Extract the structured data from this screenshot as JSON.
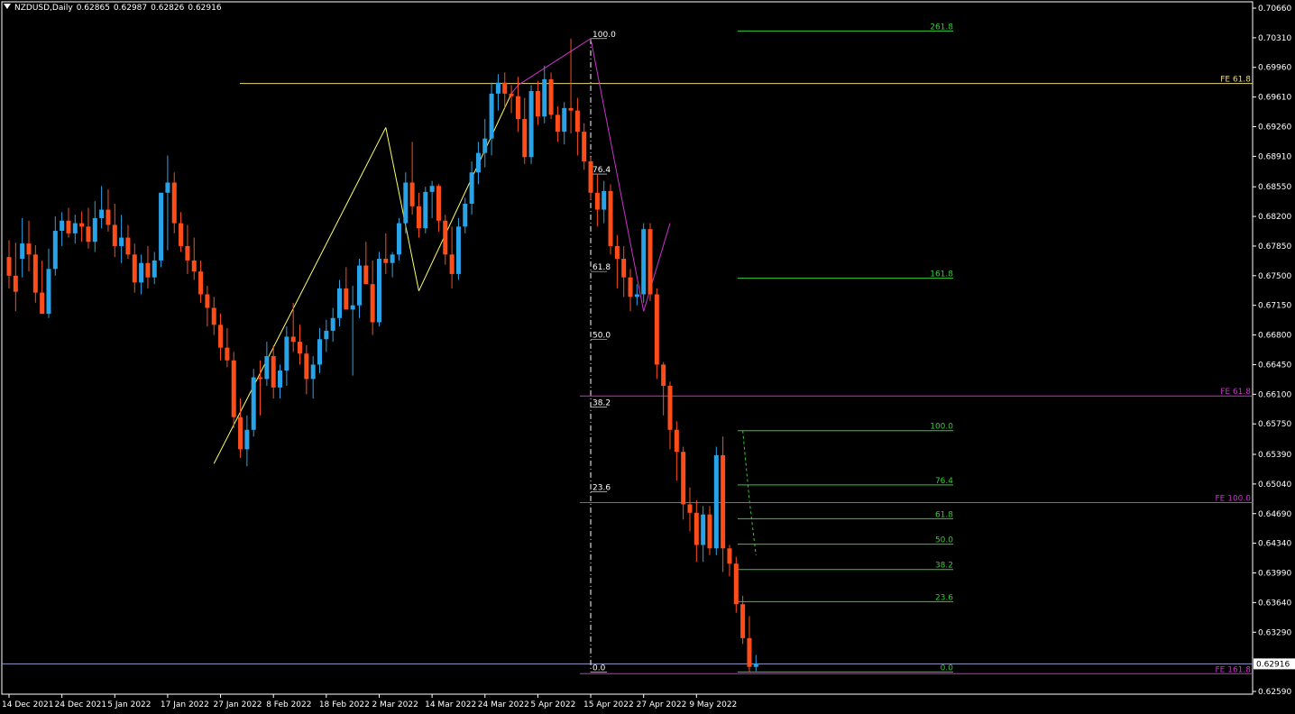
{
  "header": {
    "symbol": "NZDUSD,Daily",
    "open": "0.62865",
    "high": "0.62987",
    "low": "0.62826",
    "close": "0.62916"
  },
  "colors": {
    "background": "#000000",
    "bull": "#29a3e8",
    "bear": "#ff4d1a",
    "wick_bull": "#29a3e8",
    "wick_bear": "#ff4d1a",
    "axis": "#ffffff",
    "grid_text": "#ffffff",
    "zigzag_up": "#ffff66",
    "zigzag_down": "#cc33cc",
    "fibo_green": "#33cc33",
    "fe_yellow": "#e6d875",
    "fe_magenta": "#cc33cc",
    "current_price": "#9999cc"
  },
  "chart_data": {
    "type": "candlestick",
    "ylim": [
      0.6259,
      0.7066
    ],
    "y_ticks": [
      "0.70660",
      "0.70310",
      "0.69960",
      "0.69610",
      "0.69260",
      "0.68910",
      "0.68550",
      "0.68200",
      "0.67850",
      "0.67500",
      "0.67150",
      "0.66800",
      "0.66450",
      "0.66100",
      "0.65750",
      "0.65390",
      "0.65040",
      "0.64690",
      "0.64340",
      "0.63990",
      "0.63640",
      "0.63290",
      "0.62590"
    ],
    "current_price_label": "0.62916",
    "current_price": 0.62916,
    "x_ticks": [
      "14 Dec 2021",
      "24 Dec 2021",
      "5 Jan 2022",
      "17 Jan 2022",
      "27 Jan 2022",
      "8 Feb 2022",
      "18 Feb 2022",
      "2 Mar 2022",
      "14 Mar 2022",
      "24 Mar 2022",
      "5 Apr 2022",
      "15 Apr 2022",
      "27 Apr 2022",
      "9 May 2022"
    ],
    "candles": [
      [
        0.6772,
        0.6792,
        0.6735,
        0.675
      ],
      [
        0.675,
        0.6789,
        0.6708,
        0.6731
      ],
      [
        0.677,
        0.6818,
        0.6748,
        0.6788
      ],
      [
        0.6788,
        0.6815,
        0.6755,
        0.6775
      ],
      [
        0.6775,
        0.6786,
        0.6718,
        0.673
      ],
      [
        0.673,
        0.6768,
        0.6705,
        0.6705
      ],
      [
        0.6705,
        0.6782,
        0.67,
        0.6758
      ],
      [
        0.6758,
        0.682,
        0.675,
        0.6803
      ],
      [
        0.6803,
        0.6825,
        0.6785,
        0.6815
      ],
      [
        0.6815,
        0.683,
        0.6795,
        0.68
      ],
      [
        0.68,
        0.6822,
        0.6788,
        0.6812
      ],
      [
        0.6812,
        0.6826,
        0.679,
        0.6808
      ],
      [
        0.6808,
        0.683,
        0.6782,
        0.679
      ],
      [
        0.679,
        0.6838,
        0.6778,
        0.6818
      ],
      [
        0.6818,
        0.6856,
        0.6806,
        0.6828
      ],
      [
        0.6828,
        0.6852,
        0.6802,
        0.681
      ],
      [
        0.681,
        0.6835,
        0.6772,
        0.6785
      ],
      [
        0.6785,
        0.6822,
        0.6765,
        0.6795
      ],
      [
        0.6795,
        0.681,
        0.677,
        0.6775
      ],
      [
        0.6775,
        0.6788,
        0.673,
        0.6742
      ],
      [
        0.6742,
        0.6775,
        0.6728,
        0.6765
      ],
      [
        0.6765,
        0.6785,
        0.6735,
        0.6748
      ],
      [
        0.6748,
        0.6778,
        0.674,
        0.6768
      ],
      [
        0.6768,
        0.6822,
        0.676,
        0.6848
      ],
      [
        0.6848,
        0.6892,
        0.678,
        0.686
      ],
      [
        0.686,
        0.6872,
        0.68,
        0.6812
      ],
      [
        0.6812,
        0.6825,
        0.6778,
        0.6785
      ],
      [
        0.6785,
        0.681,
        0.6752,
        0.6768
      ],
      [
        0.6768,
        0.6795,
        0.6745,
        0.6755
      ],
      [
        0.6755,
        0.6768,
        0.6718,
        0.6728
      ],
      [
        0.6728,
        0.6738,
        0.669,
        0.6712
      ],
      [
        0.6712,
        0.6725,
        0.668,
        0.6692
      ],
      [
        0.6692,
        0.6705,
        0.665,
        0.6665
      ],
      [
        0.6665,
        0.6688,
        0.6642,
        0.665
      ],
      [
        0.665,
        0.666,
        0.657,
        0.6583
      ],
      [
        0.6583,
        0.6605,
        0.6535,
        0.6545
      ],
      [
        0.6545,
        0.6585,
        0.6525,
        0.6568
      ],
      [
        0.6568,
        0.664,
        0.656,
        0.663
      ],
      [
        0.663,
        0.665,
        0.6585,
        0.6628
      ],
      [
        0.6628,
        0.6672,
        0.662,
        0.6655
      ],
      [
        0.6655,
        0.6668,
        0.6605,
        0.6618
      ],
      [
        0.6618,
        0.6645,
        0.6605,
        0.6638
      ],
      [
        0.6638,
        0.669,
        0.662,
        0.6678
      ],
      [
        0.6678,
        0.6718,
        0.666,
        0.6672
      ],
      [
        0.6672,
        0.6692,
        0.6645,
        0.6658
      ],
      [
        0.6658,
        0.6668,
        0.661,
        0.6628
      ],
      [
        0.6628,
        0.6655,
        0.6605,
        0.6645
      ],
      [
        0.6645,
        0.6688,
        0.6635,
        0.6675
      ],
      [
        0.6675,
        0.6698,
        0.666,
        0.6685
      ],
      [
        0.6685,
        0.6712,
        0.6672,
        0.67
      ],
      [
        0.67,
        0.6745,
        0.669,
        0.6735
      ],
      [
        0.6735,
        0.676,
        0.672,
        0.671
      ],
      [
        0.671,
        0.6738,
        0.6632,
        0.6715
      ],
      [
        0.6715,
        0.677,
        0.67,
        0.6762
      ],
      [
        0.6762,
        0.679,
        0.674,
        0.674
      ],
      [
        0.674,
        0.6768,
        0.668,
        0.6695
      ],
      [
        0.6695,
        0.6778,
        0.669,
        0.677
      ],
      [
        0.677,
        0.68,
        0.6752,
        0.6765
      ],
      [
        0.6765,
        0.6778,
        0.6748,
        0.6775
      ],
      [
        0.6775,
        0.6818,
        0.6768,
        0.6812
      ],
      [
        0.6812,
        0.6872,
        0.68,
        0.686
      ],
      [
        0.686,
        0.6908,
        0.6822,
        0.6832
      ],
      [
        0.6832,
        0.6848,
        0.6795,
        0.6806
      ],
      [
        0.6806,
        0.6855,
        0.68,
        0.6849
      ],
      [
        0.6849,
        0.6862,
        0.6818,
        0.6856
      ],
      [
        0.6856,
        0.6858,
        0.6802,
        0.6815
      ],
      [
        0.6815,
        0.6822,
        0.6763,
        0.6775
      ],
      [
        0.6775,
        0.6808,
        0.6735,
        0.6752
      ],
      [
        0.6752,
        0.6818,
        0.6745,
        0.6808
      ],
      [
        0.6808,
        0.6842,
        0.68,
        0.6835
      ],
      [
        0.6835,
        0.6885,
        0.6822,
        0.6872
      ],
      [
        0.6872,
        0.6908,
        0.6858,
        0.6895
      ],
      [
        0.6895,
        0.6935,
        0.6878,
        0.6912
      ],
      [
        0.6912,
        0.6978,
        0.6892,
        0.6965
      ],
      [
        0.6965,
        0.6988,
        0.6945,
        0.6978
      ],
      [
        0.6978,
        0.699,
        0.6948,
        0.6965
      ],
      [
        0.6965,
        0.6975,
        0.6942,
        0.6962
      ],
      [
        0.6962,
        0.6985,
        0.692,
        0.6935
      ],
      [
        0.6935,
        0.696,
        0.6882,
        0.689
      ],
      [
        0.689,
        0.6975,
        0.6882,
        0.6968
      ],
      [
        0.6968,
        0.698,
        0.6928,
        0.6938
      ],
      [
        0.6938,
        0.6998,
        0.693,
        0.6982
      ],
      [
        0.6982,
        0.699,
        0.6935,
        0.694
      ],
      [
        0.694,
        0.695,
        0.6908,
        0.692
      ],
      [
        0.692,
        0.6955,
        0.6905,
        0.6948
      ],
      [
        0.6948,
        0.703,
        0.6918,
        0.6945
      ],
      [
        0.6945,
        0.696,
        0.6892,
        0.692
      ],
      [
        0.692,
        0.693,
        0.6875,
        0.6885
      ],
      [
        0.6885,
        0.689,
        0.684,
        0.6848
      ],
      [
        0.6848,
        0.687,
        0.6808,
        0.6828
      ],
      [
        0.6828,
        0.6862,
        0.6812,
        0.685
      ],
      [
        0.685,
        0.6858,
        0.6775,
        0.6785
      ],
      [
        0.6785,
        0.6798,
        0.6735,
        0.677
      ],
      [
        0.677,
        0.6785,
        0.6725,
        0.6748
      ],
      [
        0.6748,
        0.6758,
        0.6708,
        0.6725
      ],
      [
        0.6725,
        0.674,
        0.6715,
        0.6728
      ],
      [
        0.6728,
        0.6812,
        0.6718,
        0.6805
      ],
      [
        0.6805,
        0.6812,
        0.672,
        0.6728
      ],
      [
        0.6728,
        0.6735,
        0.6628,
        0.6645
      ],
      [
        0.6645,
        0.6648,
        0.6585,
        0.662
      ],
      [
        0.662,
        0.6625,
        0.6545,
        0.6568
      ],
      [
        0.6568,
        0.6578,
        0.6508,
        0.6542
      ],
      [
        0.6542,
        0.6548,
        0.6462,
        0.648
      ],
      [
        0.648,
        0.65,
        0.6448,
        0.647
      ],
      [
        0.647,
        0.6485,
        0.6412,
        0.6432
      ],
      [
        0.6432,
        0.6478,
        0.6412,
        0.6468
      ],
      [
        0.6468,
        0.6478,
        0.642,
        0.6428
      ],
      [
        0.6428,
        0.6548,
        0.642,
        0.6538
      ],
      [
        0.6538,
        0.656,
        0.64,
        0.6428
      ],
      [
        0.6428,
        0.6432,
        0.6395,
        0.641
      ],
      [
        0.641,
        0.6418,
        0.6352,
        0.6362
      ],
      [
        0.6362,
        0.6372,
        0.6315,
        0.6322
      ],
      [
        0.6322,
        0.6348,
        0.6282,
        0.6288
      ],
      [
        0.6288,
        0.6302,
        0.6283,
        0.6292
      ]
    ],
    "zigzag": [
      [
        31,
        0.6528
      ],
      [
        57,
        0.6925
      ],
      [
        62,
        0.6732
      ],
      [
        76,
        0.6965
      ],
      [
        77,
        0.6975
      ],
      [
        88,
        0.703
      ],
      [
        96,
        0.6708
      ],
      [
        100,
        0.6812
      ]
    ],
    "fibo_retracement": {
      "labels": [
        "100.0",
        "76.4",
        "61.8",
        "50.0",
        "38.2",
        "23.6",
        "0.0"
      ],
      "levels": [
        0.703,
        0.687,
        0.6755,
        0.6675,
        0.6595,
        0.6495,
        0.6282
      ]
    },
    "fibo_expansion_1": {
      "labels": [
        "261.8",
        "161.8"
      ],
      "levels": [
        0.7039,
        0.6747
      ]
    },
    "fibo_expansion_2": {
      "labels": [
        "100.0",
        "76.4",
        "61.8",
        "50.0",
        "38.2",
        "23.6",
        "0.0"
      ],
      "levels": [
        0.6567,
        0.6503,
        0.6463,
        0.6433,
        0.6403,
        0.6365,
        0.6282
      ]
    },
    "fe_lines": [
      {
        "label": "FE 61.8",
        "value": 0.6977,
        "color": "yellow"
      },
      {
        "label": "FE 61.8",
        "value": 0.6608,
        "color": "magenta"
      },
      {
        "label": "FE 100.0",
        "value": 0.6482,
        "color": "magenta"
      },
      {
        "label": "FE 161.8",
        "value": 0.628,
        "color": "magenta"
      }
    ]
  }
}
